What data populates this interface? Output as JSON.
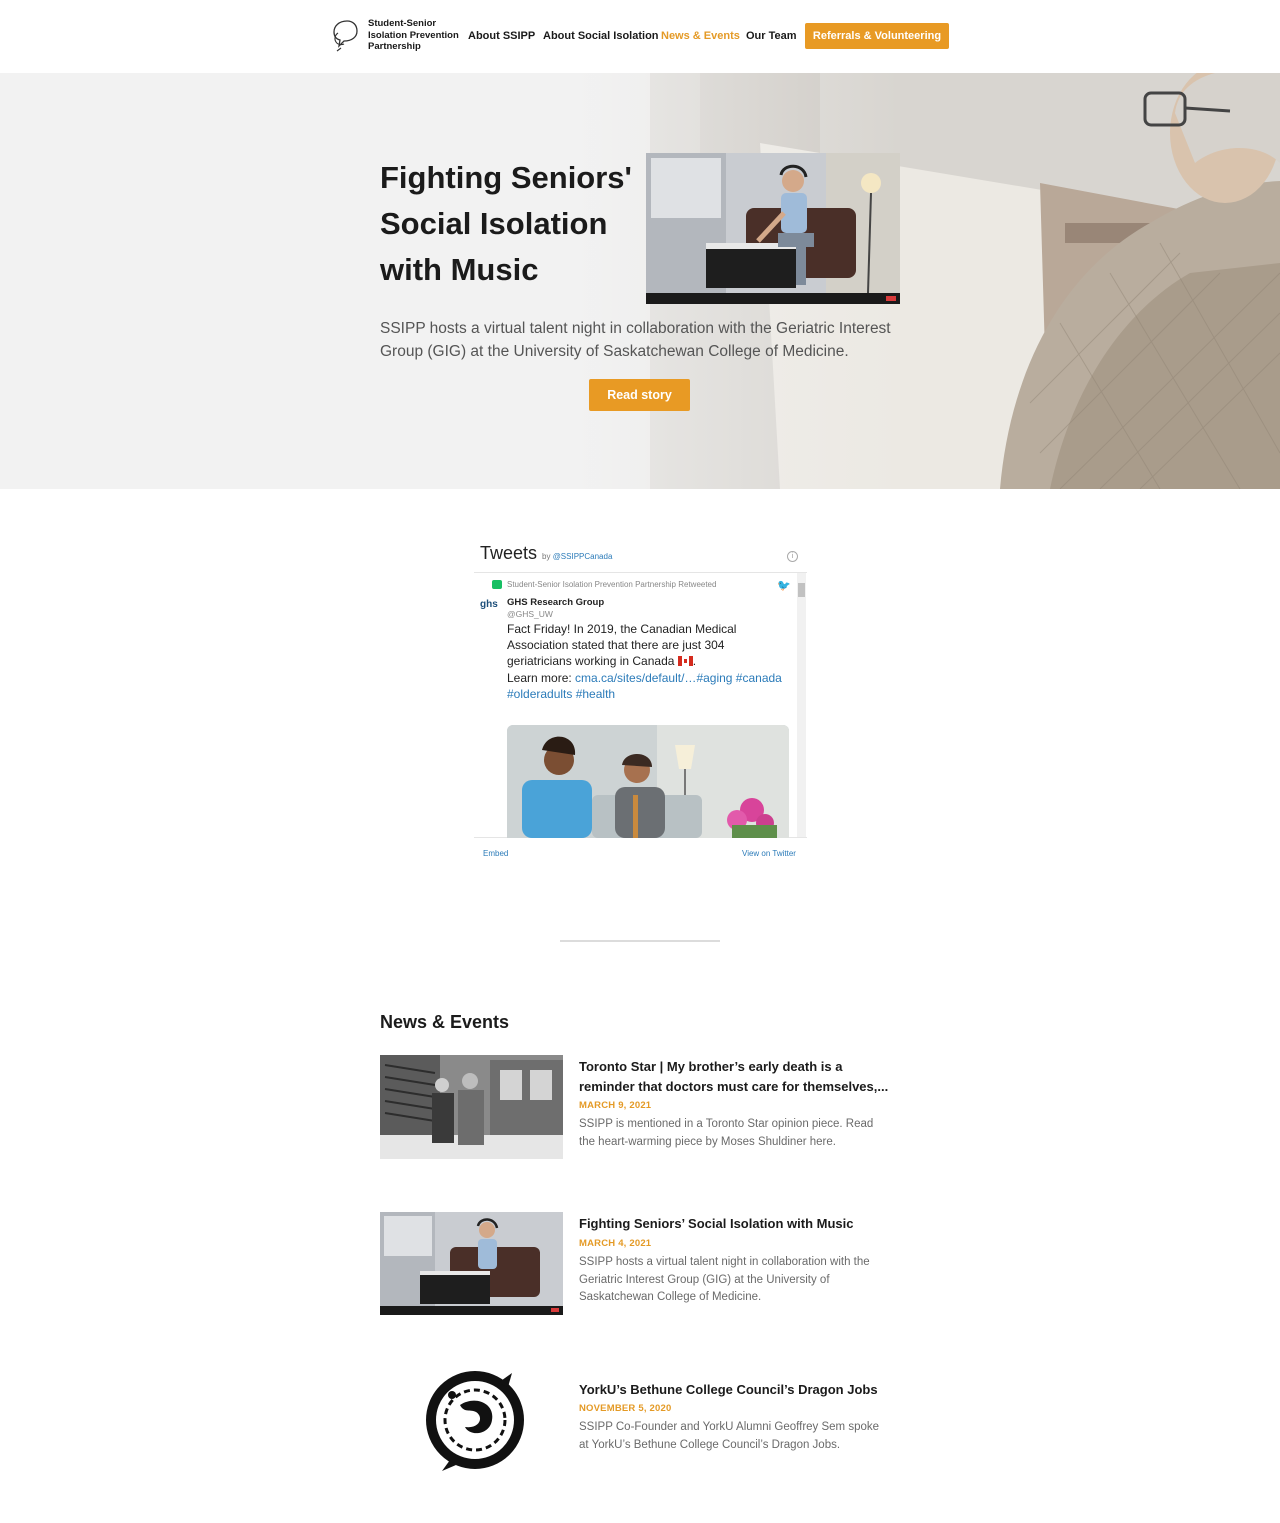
{
  "header": {
    "logo_text": "Student-Senior Isolation Prevention Partnership",
    "nav": [
      "About SSIPP",
      "About Social Isolation",
      "News & Events",
      "Our Team"
    ],
    "active_nav": "News & Events",
    "cta_label": "Referrals & Volunteering"
  },
  "hero": {
    "title": "Fighting Seniors' Social Isolation with Music",
    "description": "SSIPP hosts a virtual talent night in collaboration with the Geriatric Interest Group (GIG) at the University of Saskatchewan College of Medicine.",
    "button_label": "Read story"
  },
  "tweets": {
    "title": "Tweets",
    "by_prefix": "by",
    "by_handle": "@SSIPPCanada",
    "retweet_label": "Student-Senior Isolation Prevention Partnership Retweeted",
    "author_name": "GHS Research Group",
    "author_handle": "@GHS_UW",
    "avatar_text": "ghs",
    "text_main": "Fact Friday! In 2019, the Canadian Medical Association stated that there are just 304 geriatricians working in Canada",
    "text_learn": "Learn more:",
    "text_link": "cma.ca/sites/default/…",
    "text_tags_1": "#aging #canada",
    "text_tags_2": "#olderadults #health",
    "embed_label": "Embed",
    "view_label": "View on Twitter"
  },
  "news": {
    "heading": "News & Events",
    "items": [
      {
        "title": "Toronto Star | My brother’s early death is a reminder that doctors must care for themselves,...",
        "date": "MARCH 9, 2021",
        "excerpt": "SSIPP is mentioned in a Toronto Star opinion piece. Read the heart-warming piece by Moses Shuldiner here."
      },
      {
        "title": "Fighting Seniors’ Social Isolation with Music",
        "date": "MARCH 4, 2021",
        "excerpt": "SSIPP hosts a virtual talent night in collaboration with the Geriatric Interest Group (GIG) at the University of Saskatchewan College of Medicine."
      },
      {
        "title": "YorkU’s Bethune College Council’s Dragon Jobs",
        "date": "NOVEMBER 5, 2020",
        "excerpt": "SSIPP Co-Founder and YorkU Alumni Geoffrey Sem spoke at YorkU’s Bethune College Council’s Dragon Jobs."
      }
    ]
  },
  "colors": {
    "accent": "#e89a24",
    "link": "#2b7bb9",
    "text_dark": "#1b1b1b",
    "text_muted": "#6a6a6a"
  }
}
